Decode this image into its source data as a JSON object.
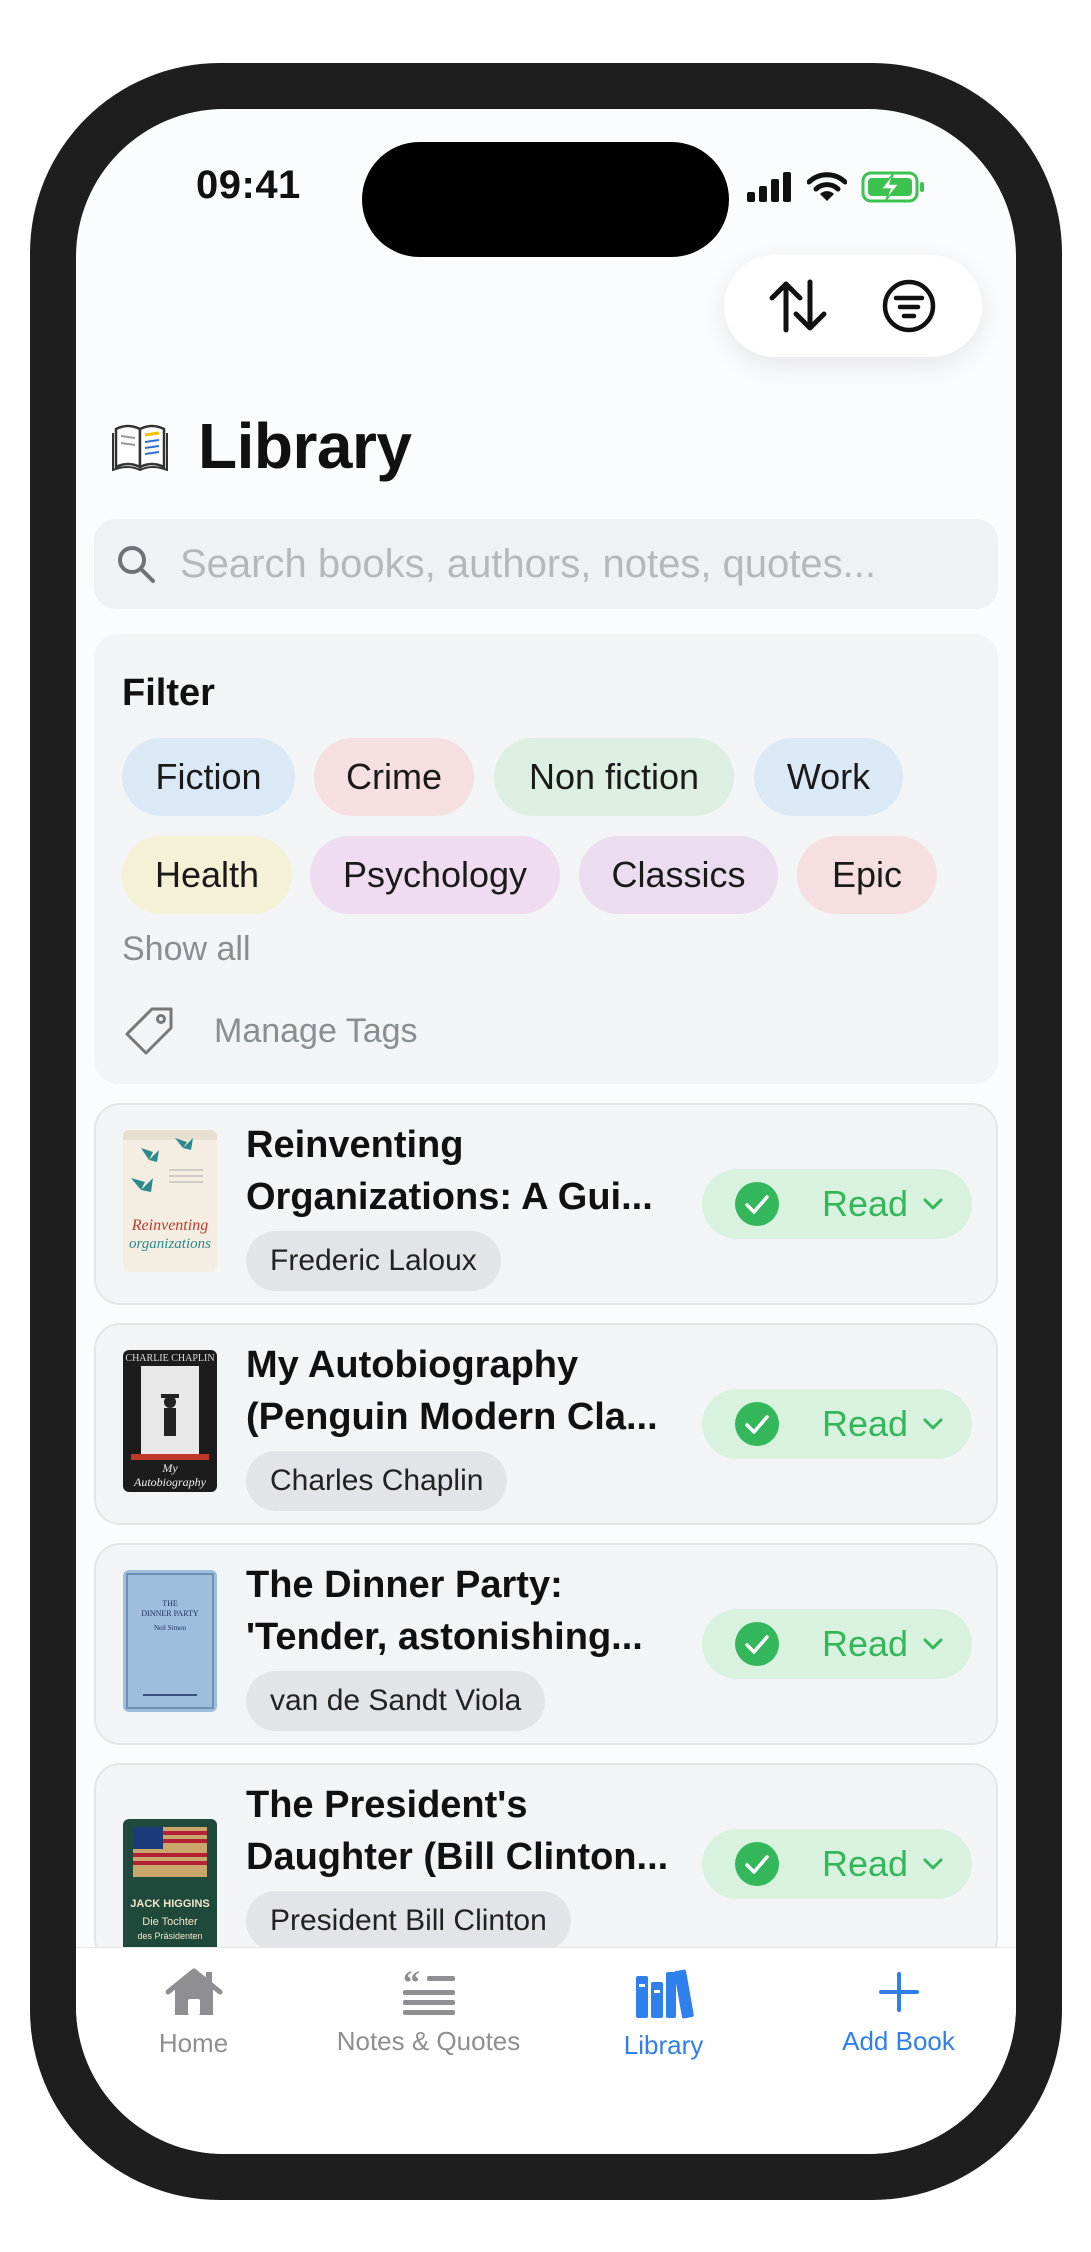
{
  "status_bar": {
    "time": "09:41"
  },
  "header": {
    "title": "Library"
  },
  "search": {
    "placeholder": "Search books, authors, notes, quotes..."
  },
  "filter": {
    "title": "Filter",
    "chips": [
      {
        "label": "Fiction",
        "color": "#dbe9f7"
      },
      {
        "label": "Crime",
        "color": "#f6dfe1"
      },
      {
        "label": "Non fiction",
        "color": "#dcefe2"
      },
      {
        "label": "Work",
        "color": "#dbe9f7"
      },
      {
        "label": "Health",
        "color": "#f5f1d6"
      },
      {
        "label": "Psychology",
        "color": "#efdcf1"
      },
      {
        "label": "Classics",
        "color": "#ebdcf0"
      },
      {
        "label": "Epic",
        "color": "#f6dfe1"
      }
    ],
    "show_all": "Show all",
    "manage_tags": "Manage Tags"
  },
  "books": [
    {
      "title": "Reinventing Organizations: A Gui...",
      "author": "Frederic Laloux",
      "status": "Read"
    },
    {
      "title": "My Autobiography (Penguin Modern Cla...",
      "author": "Charles Chaplin",
      "status": "Read"
    },
    {
      "title": "The Dinner Party: 'Tender, astonishing...",
      "author": "van de Sandt Viola",
      "status": "Read"
    },
    {
      "title": "The President's Daughter (Bill Clinton...",
      "author": "President Bill Clinton",
      "status": "Read"
    }
  ],
  "covers": {
    "book1": {
      "line1": "Reinventing",
      "line2": "organizations"
    },
    "book2": {
      "top": "CHARLIE CHAPLIN",
      "line1": "My",
      "line2": "Autobiography"
    },
    "book3": {
      "line1": "THE",
      "line2": "DINNER PARTY",
      "author": "Neil Simon"
    },
    "book4": {
      "line1": "JACK HIGGINS",
      "line2": "Die Tochter",
      "line3": "des Präsidenten"
    }
  },
  "tabbar": {
    "items": [
      {
        "label": "Home",
        "icon": "house-icon"
      },
      {
        "label": "Notes & Quotes",
        "icon": "quote-icon"
      },
      {
        "label": "Library",
        "icon": "books-icon"
      },
      {
        "label": "Add Book",
        "icon": "plus-icon"
      }
    ],
    "active": "Library"
  },
  "colors": {
    "accent": "#2f80ed",
    "read_green": "#34b65a",
    "read_bg": "#d9f2df"
  }
}
